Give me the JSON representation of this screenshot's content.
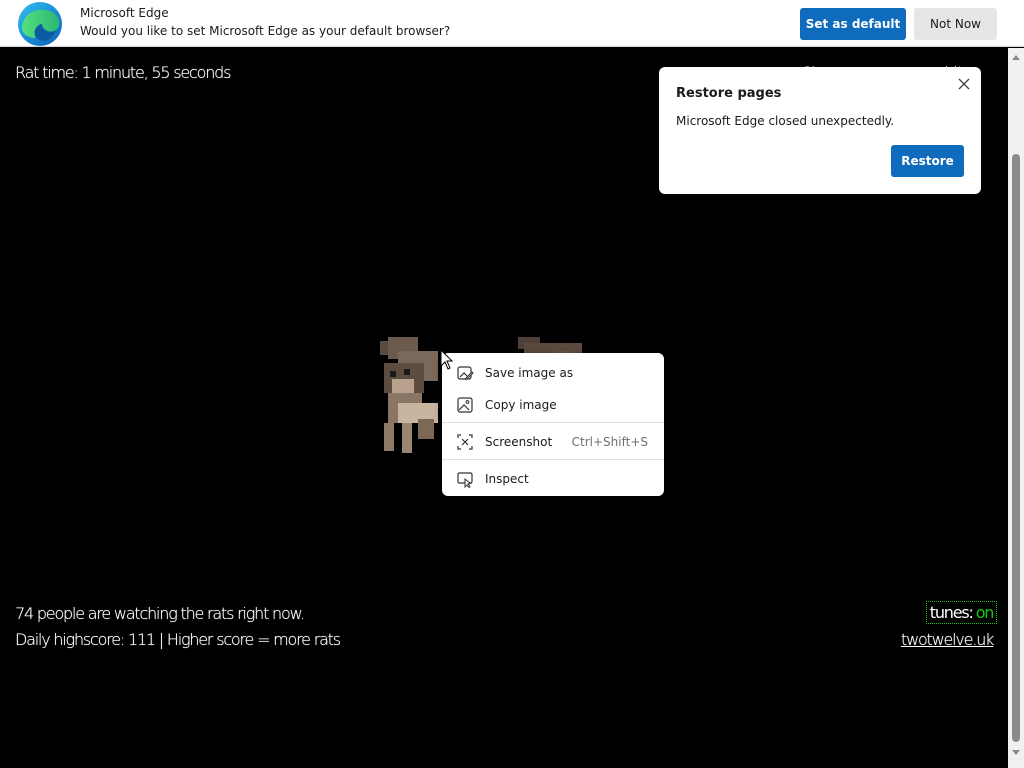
{
  "infobar": {
    "title": "Microsoft Edge",
    "message": "Would you like to set Microsoft Edge as your default browser?",
    "set_default_label": "Set as default",
    "not_now_label": "Not Now"
  },
  "page": {
    "rat_time": "Rat time: 1 minute, 55 seconds",
    "top_right_partial_link": "Sh                                ld!",
    "watching": "74 people are watching the rats right now.",
    "highscore": "Daily highscore: 111 | Higher score = more rats",
    "tunes_label": "tunes:",
    "tunes_state": "on",
    "site_link": "twotwelve.uk"
  },
  "restore_popup": {
    "title": "Restore pages",
    "message": "Microsoft Edge closed unexpectedly.",
    "restore_label": "Restore"
  },
  "context_menu": {
    "items": [
      {
        "label": "Save image as",
        "icon": "save-image-icon",
        "shortcut": ""
      },
      {
        "label": "Copy image",
        "icon": "copy-image-icon",
        "shortcut": ""
      },
      {
        "label": "Screenshot",
        "icon": "screenshot-icon",
        "shortcut": "Ctrl+Shift+S"
      },
      {
        "label": "Inspect",
        "icon": "inspect-icon",
        "shortcut": ""
      }
    ]
  },
  "colors": {
    "edge_blue": "#0f6cbd",
    "tunes_green": "#19c419",
    "page_background": "#000000"
  }
}
